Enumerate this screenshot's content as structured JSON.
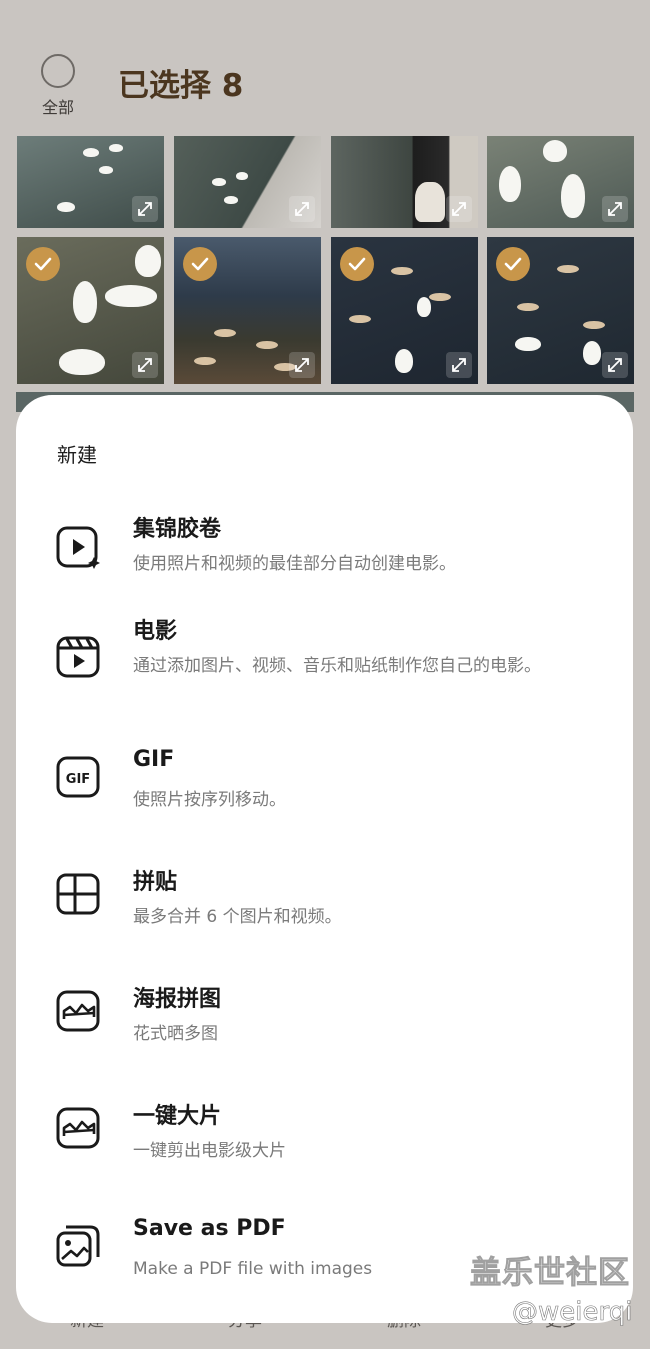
{
  "header": {
    "select_all_label": "全部",
    "title": "已选择 8"
  },
  "grid": {
    "selected_count": 8,
    "accent_color": "#c8964a"
  },
  "sheet": {
    "title": "新建",
    "items": [
      {
        "icon": "highlight-reel-icon",
        "title": "集锦胶卷",
        "desc": "使用照片和视频的最佳部分自动创建电影。"
      },
      {
        "icon": "movie-clapper-icon",
        "title": "电影",
        "desc": "通过添加图片、视频、音乐和贴纸制作您自己的电影。"
      },
      {
        "icon": "gif-icon",
        "title": "GIF",
        "desc": "使照片按序列移动。"
      },
      {
        "icon": "collage-icon",
        "title": "拼贴",
        "desc": "最多合并 6 个图片和视频。"
      },
      {
        "icon": "poster-collage-icon",
        "title": "海报拼图",
        "desc": "花式晒多图"
      },
      {
        "icon": "one-tap-blockbuster-icon",
        "title": "一键大片",
        "desc": "一键剪出电影级大片"
      },
      {
        "icon": "save-pdf-icon",
        "title": "Save as PDF",
        "desc": "Make a PDF file with images"
      }
    ]
  },
  "bottom_bar": {
    "labels": [
      "新建",
      "分享",
      "删除",
      "更多"
    ]
  },
  "watermark": {
    "line1": "盖乐世社区",
    "line2": "@weierqi"
  }
}
